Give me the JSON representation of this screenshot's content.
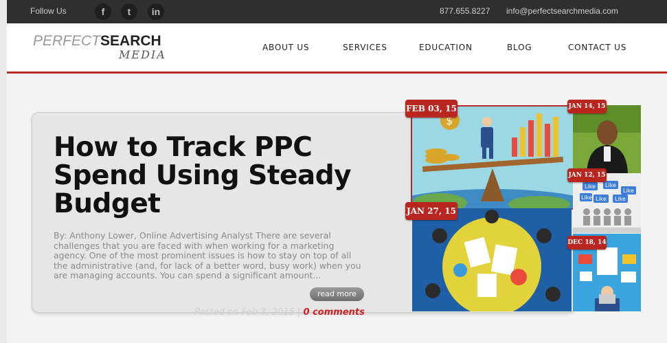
{
  "topbar": {
    "follow_label": "Follow Us",
    "social": [
      {
        "icon": "facebook-icon",
        "glyph": "f"
      },
      {
        "icon": "twitter-icon",
        "glyph": "t"
      },
      {
        "icon": "linkedin-icon",
        "glyph": "in"
      }
    ],
    "phone": "877.655.8227",
    "email": "info@perfectsearchmedia.com"
  },
  "logo": {
    "part1": "PERFECT",
    "part2": "SEARCH",
    "part3": "MEDIA"
  },
  "nav": {
    "items": [
      "ABOUT US",
      "SERVICES",
      "EDUCATION",
      "BLOG",
      "CONTACT US"
    ]
  },
  "featured": {
    "title": "How to Track PPC Spend Using Steady Budget",
    "excerpt": "By: Anthony Lower, Online Advertising Analyst There are several challenges that you are faced with when working for a marketing agency. One of the most prominent issues is how to stay on top of all the administrative (and, for lack of a better word, busy work) when you are managing accounts. You can spend a significant amount...",
    "read_more": "read more",
    "posted": "Posted on Feb 3, 2015 |",
    "comments": "0 comments"
  },
  "tiles": {
    "main": {
      "date": "FEB 03, 15"
    },
    "second": {
      "date": "JAN 27, 15"
    },
    "side1": {
      "date": "JAN 14, 15"
    },
    "side2": {
      "date": "JAN 12, 15",
      "like_text": "Like"
    },
    "side3": {
      "date": "DEC 18, 14"
    }
  },
  "colors": {
    "accent": "#b52a2a",
    "badge": "#b8261f",
    "topbar": "#2f2f2f"
  }
}
